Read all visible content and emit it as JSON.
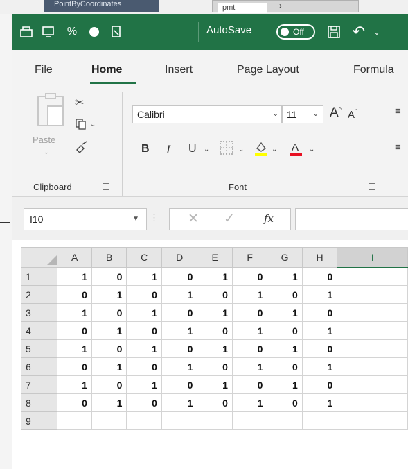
{
  "background": {
    "tab1_text": "PointByCoordinates",
    "tab2_text": "pmt"
  },
  "titlebar": {
    "autosave_label": "AutoSave",
    "autosave_state": "Off",
    "icons": [
      "open-icon",
      "screenshot-icon",
      "percent-icon",
      "record-icon",
      "copy-format-icon",
      "save-icon",
      "undo-icon"
    ],
    "color": "#217346"
  },
  "tabs": [
    "File",
    "Home",
    "Insert",
    "Page Layout",
    "Formula"
  ],
  "active_tab": "Home",
  "ribbon": {
    "paste_label": "Paste",
    "clipboard_group": "Clipboard",
    "font_group": "Font",
    "font_name": "Calibri",
    "font_size": "11",
    "bold": "B",
    "italic": "I",
    "underline": "U",
    "grow_font": "A",
    "shrink_font": "A",
    "font_color_letter": "A",
    "highlight_color": "#ffff00",
    "font_color": "#e81123"
  },
  "formula_bar": {
    "name_box": "I10",
    "fx": "fx",
    "value": ""
  },
  "sheet": {
    "columns": [
      "A",
      "B",
      "C",
      "D",
      "E",
      "F",
      "G",
      "H",
      "I"
    ],
    "selected_column": "I",
    "rows": [
      {
        "num": "1",
        "cells": [
          "1",
          "0",
          "1",
          "0",
          "1",
          "0",
          "1",
          "0"
        ]
      },
      {
        "num": "2",
        "cells": [
          "0",
          "1",
          "0",
          "1",
          "0",
          "1",
          "0",
          "1"
        ]
      },
      {
        "num": "3",
        "cells": [
          "1",
          "0",
          "1",
          "0",
          "1",
          "0",
          "1",
          "0"
        ]
      },
      {
        "num": "4",
        "cells": [
          "0",
          "1",
          "0",
          "1",
          "0",
          "1",
          "0",
          "1"
        ]
      },
      {
        "num": "5",
        "cells": [
          "1",
          "0",
          "1",
          "0",
          "1",
          "0",
          "1",
          "0"
        ]
      },
      {
        "num": "6",
        "cells": [
          "0",
          "1",
          "0",
          "1",
          "0",
          "1",
          "0",
          "1"
        ]
      },
      {
        "num": "7",
        "cells": [
          "1",
          "0",
          "1",
          "0",
          "1",
          "0",
          "1",
          "0"
        ]
      },
      {
        "num": "8",
        "cells": [
          "0",
          "1",
          "0",
          "1",
          "0",
          "1",
          "0",
          "1"
        ]
      },
      {
        "num": "9",
        "cells": [
          "",
          "",
          "",
          "",
          "",
          "",
          "",
          ""
        ]
      }
    ]
  }
}
